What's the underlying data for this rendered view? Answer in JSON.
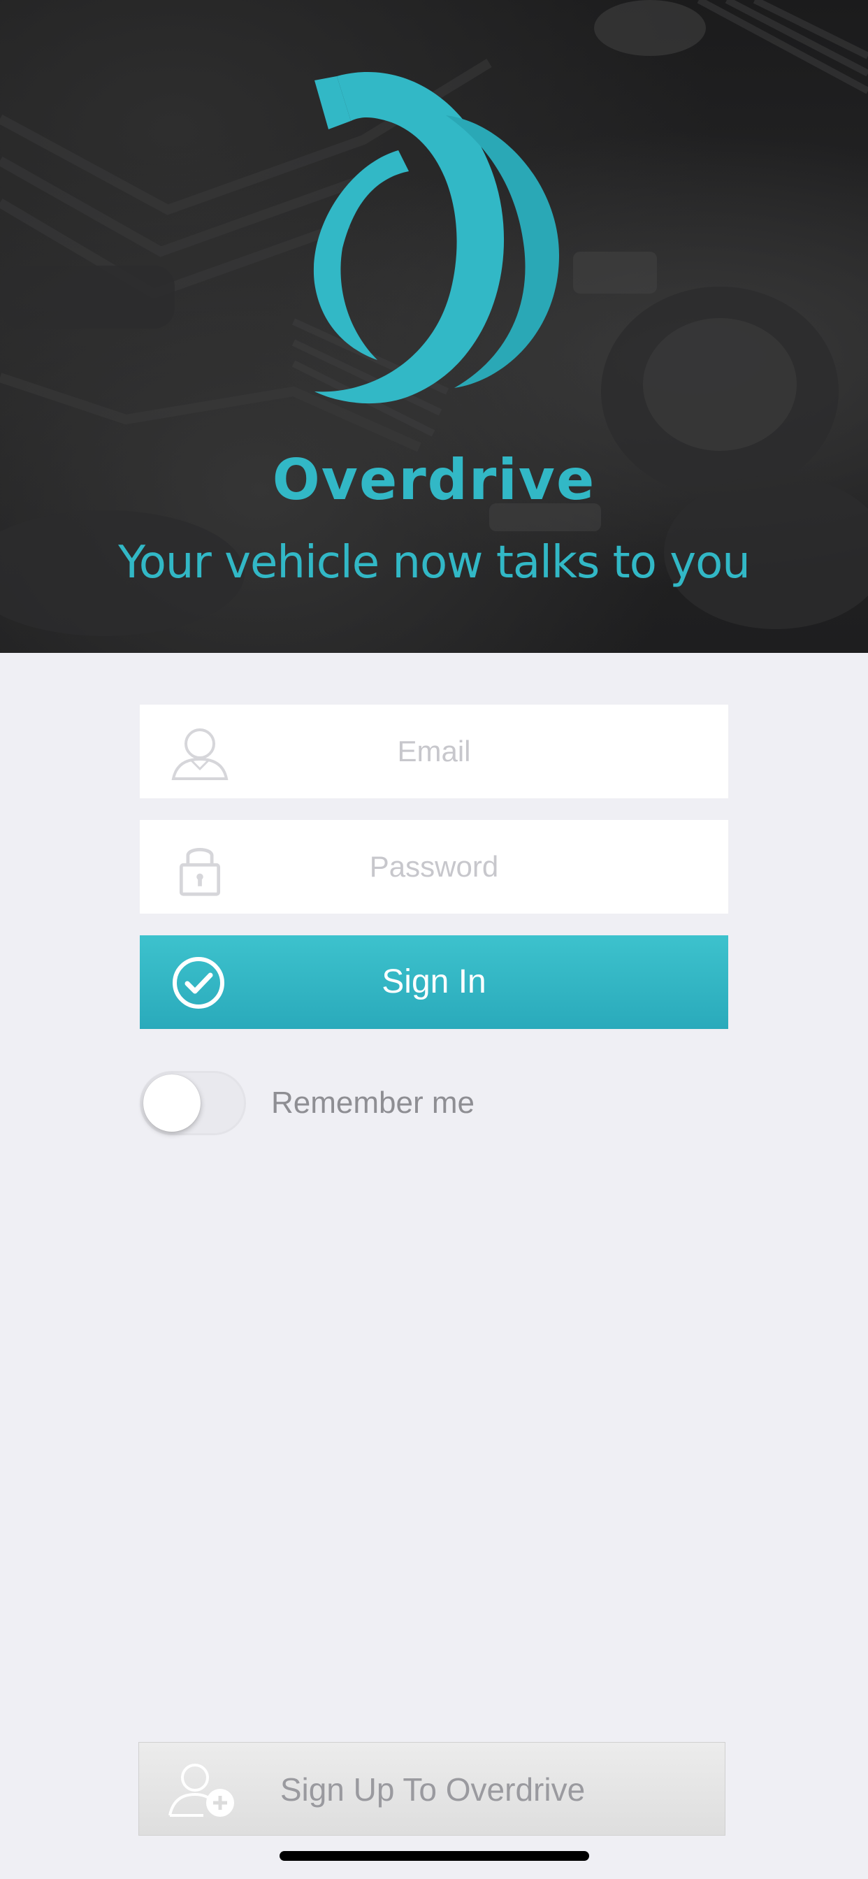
{
  "brand": {
    "name": "Overdrive",
    "tagline": "Your vehicle now talks to you",
    "accent_color": "#32b8c6",
    "logo_icon": "overdrive-logo"
  },
  "form": {
    "email": {
      "value": "",
      "placeholder": "Email",
      "icon": "user-icon"
    },
    "password": {
      "value": "",
      "placeholder": "Password",
      "icon": "lock-icon"
    },
    "sign_in": {
      "label": "Sign In",
      "icon": "checkmark-circle-icon",
      "color": "#32b8c6"
    },
    "remember_me": {
      "label": "Remember me",
      "checked": false
    }
  },
  "footer": {
    "sign_up": {
      "label": "Sign Up To Overdrive",
      "icon": "add-user-icon"
    }
  }
}
